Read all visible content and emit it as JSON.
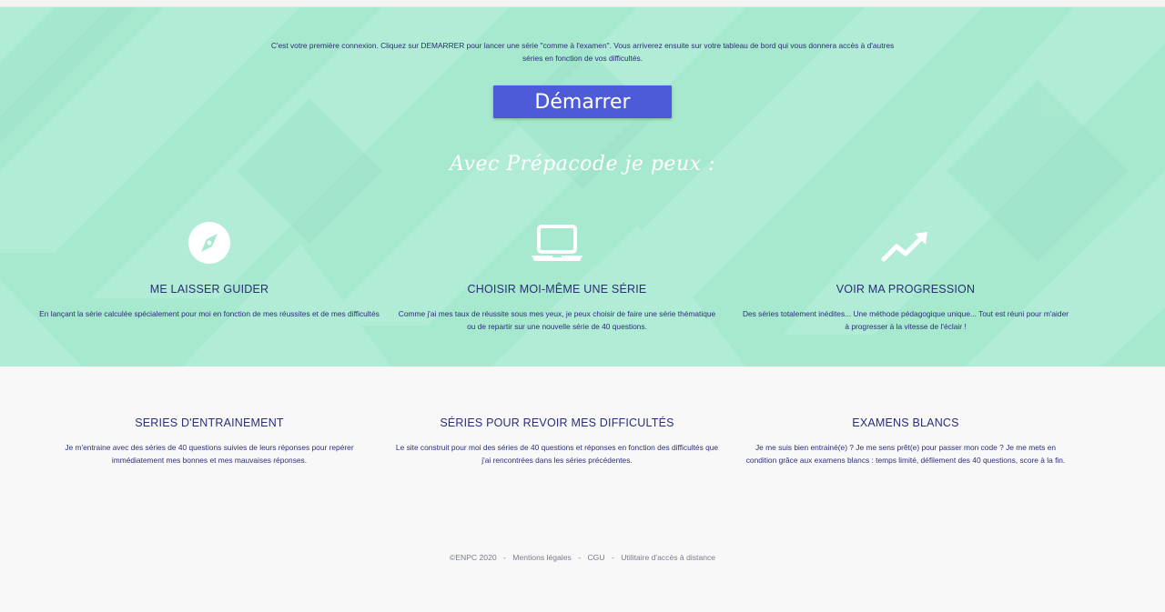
{
  "intro_text": "C'est votre première connexion. Cliquez sur DEMARRER pour lancer une série \"comme à l'examen\". Vous arriverez ensuite sur votre tableau de bord qui vous donnera accès à d'autres séries en fonction de vos difficultés.",
  "start_button": "Démarrer",
  "tagline": "Avec Prépacode je peux :",
  "colors": {
    "hero_bg": "#a6e9cf",
    "accent": "#4d5bd9",
    "text": "#2b2f76"
  },
  "features": [
    {
      "icon": "compass-icon",
      "title": "ME LAISSER GUIDER",
      "text": "En lançant la série calculée spécialement pour moi en fonction de mes réussites et de mes difficultés"
    },
    {
      "icon": "laptop-icon",
      "title": "CHOISIR MOI-MÊME UNE SÉRIE",
      "text": "Comme j'ai mes taux de réussite sous mes yeux, je peux choisir de faire une série thématique ou de repartir sur une nouvelle série de 40 questions."
    },
    {
      "icon": "trending-up-icon",
      "title": "VOIR MA PROGRESSION",
      "text": "Des séries totalement inédites... Une méthode pédagogique unique... Tout est réuni pour m'aider à progresser à la vitesse de l'éclair !"
    }
  ],
  "info": [
    {
      "title": "SERIES D'ENTRAINEMENT",
      "text": "Je m'entraine avec des séries de 40 questions suivies de leurs réponses pour repérer immédiatement mes bonnes et mes mauvaises réponses."
    },
    {
      "title": "SÉRIES POUR REVOIR MES DIFFICULTÉS",
      "text": "Le site construit pour moi des séries de 40 questions et réponses en fonction des difficultés que j'ai rencontrées dans les séries précédentes."
    },
    {
      "title": "EXAMENS BLANCS",
      "text": "Je me suis bien entrainé(e) ? Je me sens prêt(e) pour passer mon code ? Je me mets en condition grâce aux examens blancs : temps limité, défilement des 40 questions, score à la fin."
    }
  ],
  "footer": {
    "copyright": "©ENPC 2020",
    "links": [
      "Mentions légales",
      "CGU",
      "Utilitaire d'accès à distance"
    ]
  }
}
